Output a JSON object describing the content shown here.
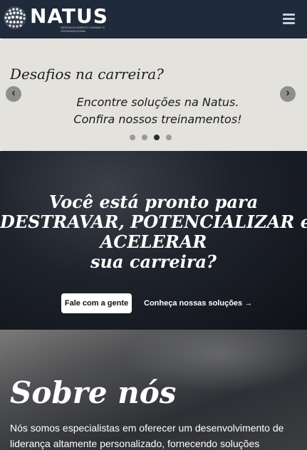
{
  "header": {
    "brand": "NATUS",
    "tagline": "DESENVOLVIMENTO HUMANO E ORGANIZACIONAL",
    "icons": {
      "logo": "globe-dots-icon",
      "menu": "hamburger-menu-icon"
    }
  },
  "carousel": {
    "title": "Desafios na carreira?",
    "line1": "Encontre soluções na Natus.",
    "line2": "Confira nossos treinamentos!",
    "prev_label": "‹",
    "next_label": "›",
    "slide_count": 4,
    "active_index": 2
  },
  "hero": {
    "line1": "Você está pronto para",
    "line2": "DESTRAVAR, POTENCIALIZAR e",
    "line3": "ACELERAR",
    "line4": "sua carreira?",
    "primary_button": "Fale com a gente",
    "secondary_link": "Conheça nossas soluções →"
  },
  "about": {
    "title": "Sobre nós",
    "text": "Nós somos especialistas em oferecer um desenvolvimento de liderança altamente personalizado, fornecendo soluções"
  },
  "colors": {
    "navbar": "#1f2a3a",
    "carousel_bg": "#e3e2dd",
    "hero_dark": "#1e222b",
    "active_dot": "#2c2c2c"
  }
}
